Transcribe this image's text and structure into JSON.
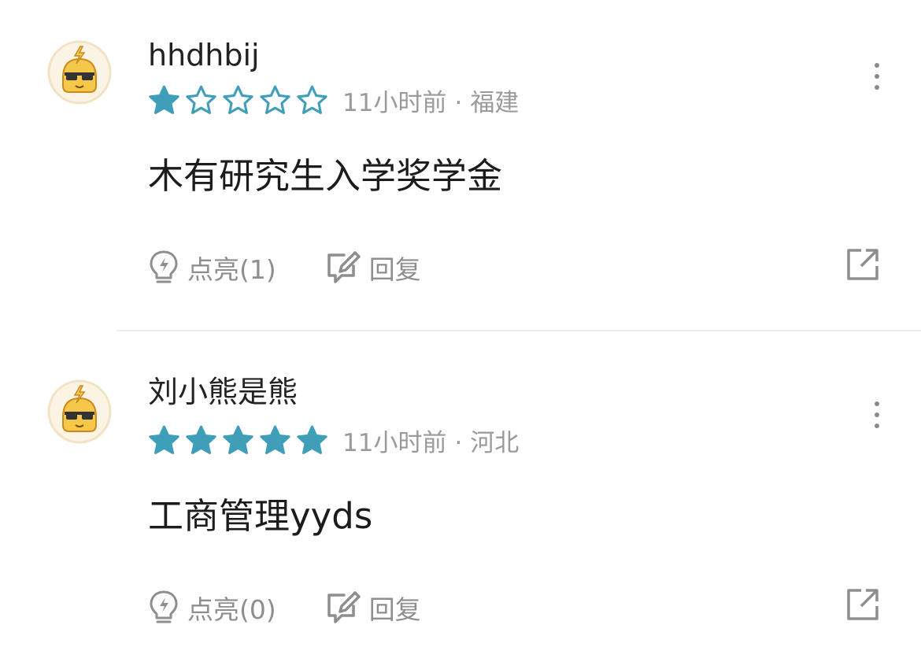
{
  "colors": {
    "star_filled": "#3f9fb8",
    "star_outline": "#3f9fb8",
    "meta_text": "#9a9a9a",
    "action_text": "#8e8e8e",
    "icon_gray": "#8e8e8e",
    "avatar_fill": "#f5c84c",
    "avatar_ring": "#f1e3c3"
  },
  "comments": [
    {
      "username": "hhdhbij",
      "rating": 1,
      "rating_max": 5,
      "time": "11小时前",
      "separator": "·",
      "location": "福建",
      "content": "木有研究生入学奖学金",
      "like_label": "点亮(1)",
      "reply_label": "回复",
      "icons": {
        "avatar": "sunglasses-bolt-avatar",
        "like": "lightbulb-icon",
        "reply": "edit-bubble-icon",
        "share": "share-external-icon",
        "more": "more-vertical-icon"
      }
    },
    {
      "username": "刘小熊是熊",
      "rating": 5,
      "rating_max": 5,
      "time": "11小时前",
      "separator": "·",
      "location": "河北",
      "content": "工商管理yyds",
      "like_label": "点亮(0)",
      "reply_label": "回复",
      "icons": {
        "avatar": "sunglasses-bolt-avatar",
        "like": "lightbulb-icon",
        "reply": "edit-bubble-icon",
        "share": "share-external-icon",
        "more": "more-vertical-icon"
      }
    }
  ]
}
